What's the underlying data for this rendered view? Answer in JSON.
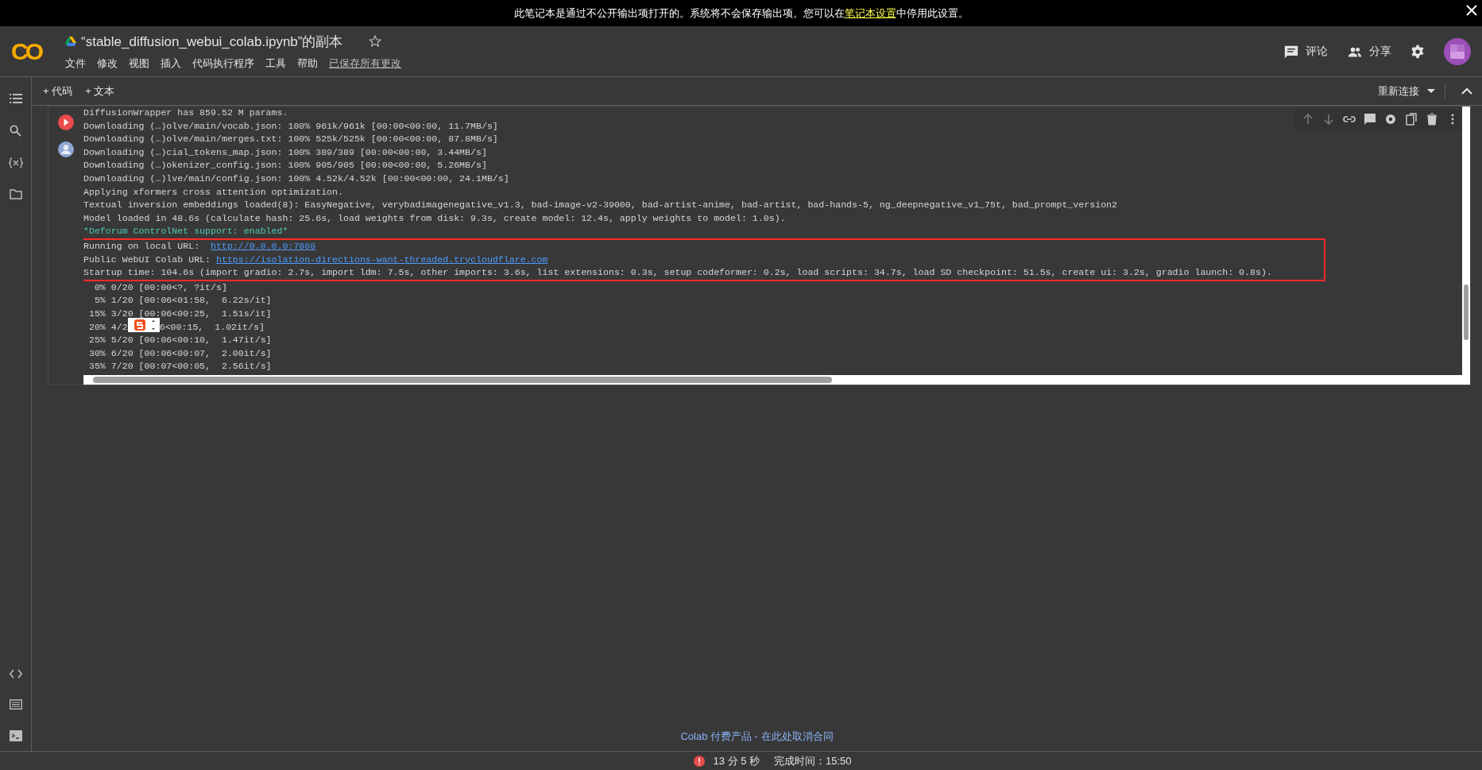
{
  "banner": {
    "before": "此笔记本是通过不公开输出项打开的。系统将不会保存输出项。您可以在",
    "link": "笔记本设置",
    "after": "中停用此设置。"
  },
  "header": {
    "logo": "CO",
    "title": "“stable_diffusion_webui_colab.ipynb”的副本",
    "starred": false,
    "menu": [
      "文件",
      "修改",
      "视图",
      "插入",
      "代码执行程序",
      "工具",
      "帮助"
    ],
    "saved_status": "已保存所有更改",
    "actions": [
      {
        "kind": "comment",
        "label": "评论"
      },
      {
        "kind": "share",
        "label": "分享"
      }
    ]
  },
  "toolbar": {
    "add": [
      {
        "label": "+ 代码"
      },
      {
        "label": "+ 文本"
      }
    ],
    "connect": "重新连接"
  },
  "output": [
    {
      "kind": "plain",
      "text": "DiffusionWrapper has 859.52 M params."
    },
    {
      "kind": "plain",
      "text": "Downloading (…)olve/main/vocab.json: 100% 961k/961k [00:00<00:00, 11.7MB/s]"
    },
    {
      "kind": "plain",
      "text": "Downloading (…)olve/main/merges.txt: 100% 525k/525k [00:00<00:00, 87.8MB/s]"
    },
    {
      "kind": "plain",
      "text": "Downloading (…)cial_tokens_map.json: 100% 389/389 [00:00<00:00, 3.44MB/s]"
    },
    {
      "kind": "plain",
      "text": "Downloading (…)okenizer_config.json: 100% 905/905 [00:00<00:00, 5.26MB/s]"
    },
    {
      "kind": "plain",
      "text": "Downloading (…)lve/main/config.json: 100% 4.52k/4.52k [00:00<00:00, 24.1MB/s]"
    },
    {
      "kind": "plain",
      "text": "Applying xformers cross attention optimization."
    },
    {
      "kind": "plain",
      "text": "Textual inversion embeddings loaded(8): EasyNegative, verybadimagenegative_v1.3, bad-image-v2-39000, bad-artist-anime, bad-artist, bad-hands-5, ng_deepnegative_v1_75t, bad_prompt_version2"
    },
    {
      "kind": "plain",
      "text": "Model loaded in 48.6s (calculate hash: 25.6s, load weights from disk: 9.3s, create model: 12.4s, apply weights to model: 1.0s)."
    },
    {
      "kind": "green",
      "text": "*Deforum ControlNet support: enabled*"
    },
    {
      "kind": "link",
      "text": "Running on local URL:  ",
      "link": "http://0.0.0.0:7860",
      "highlighted": true
    },
    {
      "kind": "link",
      "text": "Public WebUI Colab URL: ",
      "link": "https://isolation-directions-want-threaded.trycloudflare.com",
      "highlighted": true
    },
    {
      "kind": "plain",
      "text": "Startup time: 104.6s (import gradio: 2.7s, import ldm: 7.5s, other imports: 3.6s, list extensions: 0.3s, setup codeformer: 0.2s, load scripts: 34.7s, load SD checkpoint: 51.5s, create ui: 3.2s, gradio launch: 0.8s).",
      "highlighted": true
    },
    {
      "kind": "plain",
      "text": "  0% 0/20 [00:00<?, ?it/s]"
    },
    {
      "kind": "plain",
      "text": "  5% 1/20 [00:06<01:58,  6.22s/it]"
    },
    {
      "kind": "plain",
      "text": " 15% 3/20 [00:06<00:25,  1.51s/it]"
    },
    {
      "kind": "covered",
      "text": " 20% 4/2",
      "rest": "6<00:15,  1.02it/s]"
    },
    {
      "kind": "plain",
      "text": " 25% 5/20 [00:06<00:10,  1.47it/s]"
    },
    {
      "kind": "plain",
      "text": " 30% 6/20 [00:06<00:07,  2.00it/s]"
    },
    {
      "kind": "plain",
      "text": " 35% 7/20 [00:07<00:05,  2.56it/s]"
    }
  ],
  "footer": {
    "link": "Colab 付费产品 - 在此处取消合同",
    "elapsed": "13 分 5 秒",
    "done": "完成时间：15:50"
  }
}
